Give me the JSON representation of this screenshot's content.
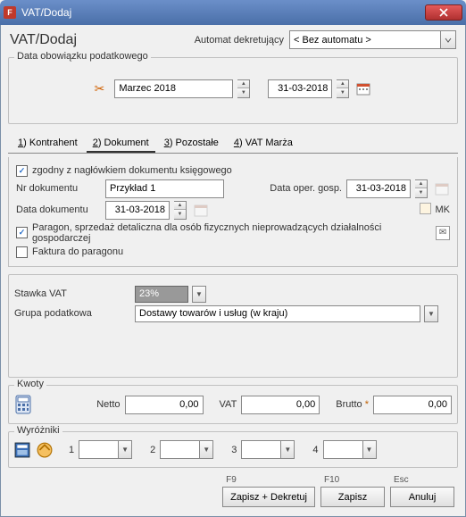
{
  "window": {
    "app_badge": "F",
    "title": "VAT/Dodaj"
  },
  "header": {
    "title": "VAT/Dodaj",
    "automat_label": "Automat dekretujący",
    "automat_value": "< Bez automatu >"
  },
  "duty": {
    "group_label": "Data obowiązku podatkowego",
    "period": "Marzec 2018",
    "date": "31-03-2018"
  },
  "tabs": [
    {
      "key": "1",
      "label": "Kontrahent"
    },
    {
      "key": "2",
      "label": "Dokument"
    },
    {
      "key": "3",
      "label": "Pozostałe"
    },
    {
      "key": "4",
      "label": "VAT Marża"
    }
  ],
  "doc": {
    "consistent_label": "zgodny z nagłówkiem dokumentu księgowego",
    "nr_label": "Nr dokumentu",
    "nr_value": "Przykład 1",
    "oper_label": "Data oper. gosp.",
    "oper_value": "31-03-2018",
    "docdate_label": "Data dokumentu",
    "docdate_value": "31-03-2018",
    "mk_label": "MK",
    "paragon_label": "Paragon, sprzedaż detaliczna dla osób fizycznych nieprowadzących działalności gospodarczej",
    "faktura_label": "Faktura do paragonu"
  },
  "vat": {
    "rate_label": "Stawka VAT",
    "rate_value": "23%",
    "group_label": "Grupa podatkowa",
    "group_value": "Dostawy towarów i usług (w kraju)"
  },
  "amounts": {
    "group_label": "Kwoty",
    "netto_label": "Netto",
    "netto_value": "0,00",
    "vat_label": "VAT",
    "vat_value": "0,00",
    "brutto_label": "Brutto",
    "brutto_value": "0,00"
  },
  "wyr": {
    "group_label": "Wyróżniki",
    "items": [
      "1",
      "2",
      "3",
      "4"
    ]
  },
  "footer": {
    "f9": "F9",
    "f10": "F10",
    "esc": "Esc",
    "save_decree": "Zapisz + Dekretuj",
    "save": "Zapisz",
    "cancel": "Anuluj"
  }
}
